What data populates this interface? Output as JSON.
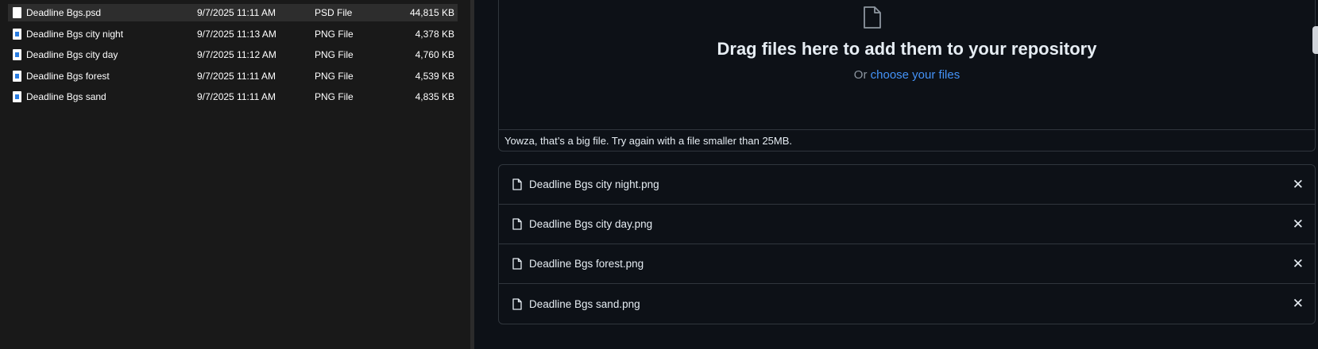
{
  "explorer": {
    "files": [
      {
        "name": "Deadline Bgs.psd",
        "date": "9/7/2025 11:11 AM",
        "type": "PSD File",
        "size": "44,815 KB",
        "icon": "psd-file-icon",
        "selected": true
      },
      {
        "name": "Deadline Bgs city night",
        "date": "9/7/2025 11:13 AM",
        "type": "PNG File",
        "size": "4,378 KB",
        "icon": "png-file-icon"
      },
      {
        "name": "Deadline Bgs city day",
        "date": "9/7/2025 11:12 AM",
        "type": "PNG File",
        "size": "4,760 KB",
        "icon": "png-file-icon"
      },
      {
        "name": "Deadline Bgs forest",
        "date": "9/7/2025 11:11 AM",
        "type": "PNG File",
        "size": "4,539 KB",
        "icon": "png-file-icon"
      },
      {
        "name": "Deadline Bgs sand",
        "date": "9/7/2025 11:11 AM",
        "type": "PNG File",
        "size": "4,835 KB",
        "icon": "png-file-icon"
      }
    ]
  },
  "upload": {
    "title": "Drag files here to add them to your repository",
    "or_text": "Or",
    "choose_link": "choose your files",
    "error": "Yowza, that’s a big file. Try again with a file smaller than 25MB.",
    "files": [
      "Deadline Bgs city night.png",
      "Deadline Bgs city day.png",
      "Deadline Bgs forest.png",
      "Deadline Bgs sand.png"
    ],
    "remove_label": "✕"
  },
  "colors": {
    "link": "#4493f8",
    "bg": "#0d1117",
    "explorer_bg": "#191919"
  }
}
